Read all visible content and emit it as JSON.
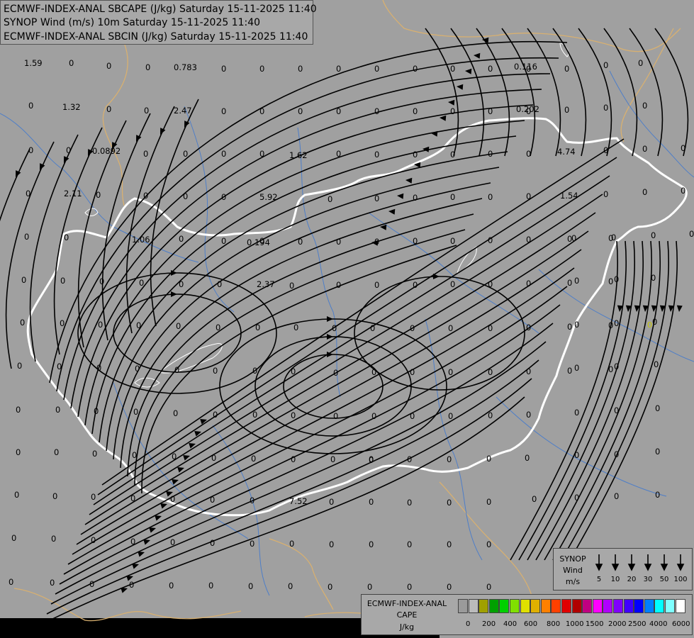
{
  "header": {
    "line1": "ECMWF-INDEX-ANAL SBCAPE (J/kg) Saturday 15-11-2025 11:40",
    "line2": "SYNOP Wind (m/s) 10m Saturday 15-11-2025 11:40",
    "line3": "ECMWF-INDEX-ANAL SBCIN (J/kg) Saturday 15-11-2025 11:40"
  },
  "colors": {
    "background": "#a0a0a0",
    "border_white": "#ffffff",
    "borders_tan": "#d8b070",
    "rivers_blue": "#4e7ec8",
    "streamlines": "#000000"
  },
  "values": [
    "1.59",
    "0",
    "0",
    "0",
    "0.783",
    "0",
    "0",
    "0",
    "0",
    "0",
    "0",
    "0",
    "0",
    "0",
    "0",
    "0",
    "0.116",
    "0",
    "0",
    "1.32",
    "0",
    "0",
    "2.47",
    "0",
    "0",
    "0",
    "0",
    "0",
    "0",
    "0",
    "0",
    "0",
    "0.202",
    "0",
    "0",
    "0",
    "0",
    "0",
    "0.0892",
    "0",
    "0",
    "0",
    "0",
    "1.62",
    "0",
    "0",
    "0",
    "0",
    "0",
    "0",
    "4.74",
    "0",
    "0",
    "0",
    "0",
    "2.11",
    "0",
    "0",
    "0",
    "0",
    "5.92",
    "0",
    "0",
    "0",
    "0",
    "0",
    "0",
    "1.54",
    "0",
    "0",
    "0",
    "0",
    "0",
    "1.06",
    "0",
    "0",
    "0",
    "0.194",
    "0",
    "0",
    "0",
    "0",
    "0",
    "0",
    "0",
    "0",
    "0",
    "0",
    "0",
    "0",
    "0",
    "0",
    "0",
    "2.37",
    "0",
    "0",
    "0",
    "0",
    "0",
    "0",
    "0",
    "0",
    "0",
    "0",
    "0",
    "0",
    "0",
    "0",
    "0",
    "0",
    "0",
    "0",
    "0",
    "0",
    "0",
    "0",
    "0",
    "0",
    "0",
    "0",
    "0",
    "0",
    "0",
    "0",
    "0",
    "0",
    "0",
    "0",
    "0",
    "0",
    "0",
    "0",
    "0",
    "0",
    "0",
    "0",
    "0",
    "0",
    "0",
    "0",
    "0",
    "0",
    "0",
    "0",
    "0",
    "0",
    "0",
    "0",
    "0",
    "0",
    "0",
    "0",
    "0",
    "0",
    "0",
    "0",
    "0",
    "0",
    "0",
    "0",
    "0",
    "0",
    "0",
    "0",
    "0",
    "0",
    "0",
    "0",
    "0",
    "0",
    "0",
    "7.52",
    "0",
    "0",
    "0",
    "0",
    "0",
    "0",
    "0",
    "0",
    "0",
    "0",
    "0",
    "0",
    "0",
    "0",
    "0",
    "0",
    "0",
    "0",
    "0",
    "0",
    "0",
    "0",
    "0",
    "0",
    "0",
    "0",
    "0",
    "0",
    "0",
    "0",
    "0",
    "0",
    "0",
    "0",
    "0",
    "0",
    "0",
    "0",
    "0",
    "0",
    "0",
    "0",
    "0",
    "0",
    "0",
    "0",
    "0",
    "0",
    "0",
    "0",
    "0",
    "0",
    "0",
    "0",
    "0"
  ],
  "wind_legend": {
    "title": "SYNOP",
    "subtitle": "Wind",
    "unit": "m/s",
    "speeds": [
      "5",
      "10",
      "20",
      "30",
      "50",
      "100"
    ]
  },
  "cape_legend": {
    "title": "ECMWF-INDEX-ANAL",
    "subtitle": "CAPE",
    "unit": "J/kg",
    "labels": [
      "0",
      "200",
      "400",
      "600",
      "800",
      "1000",
      "1500",
      "2000",
      "2500",
      "4000",
      "6000"
    ],
    "swatches": [
      "#9a9a9a",
      "#bbbbbb",
      "#a0a000",
      "#00a000",
      "#00d000",
      "#80e000",
      "#e0e000",
      "#e0b000",
      "#ff8000",
      "#ff4000",
      "#e00000",
      "#b00000",
      "#c00080",
      "#ff00ff",
      "#b000ff",
      "#8000ff",
      "#4000ff",
      "#0000ff",
      "#0080ff",
      "#00ffff",
      "#80ffff",
      "#ffffff"
    ]
  },
  "marker": "0"
}
